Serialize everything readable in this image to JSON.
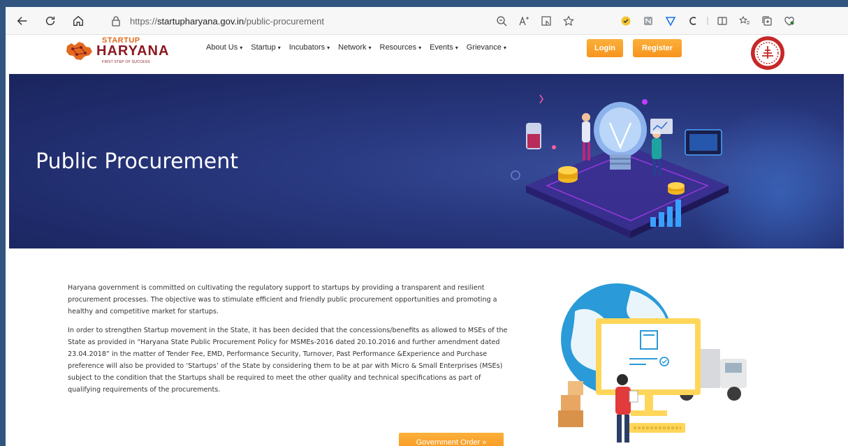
{
  "browser": {
    "url_prefix": "https://",
    "url_host": "startupharyana.gov.in",
    "url_path": "/public-procurement",
    "back_icon": "back-arrow-icon",
    "refresh_icon": "refresh-icon",
    "home_icon": "home-icon"
  },
  "site": {
    "logo_top": "STARTUP",
    "logo_main": "HARYANA",
    "logo_tagline": "FIRST STEP OF SUCCESS",
    "nav": [
      {
        "label": "About Us"
      },
      {
        "label": "Startup"
      },
      {
        "label": "Incubators"
      },
      {
        "label": "Network"
      },
      {
        "label": "Resources"
      },
      {
        "label": "Events"
      },
      {
        "label": "Grievance"
      }
    ],
    "login_label": "Login",
    "register_label": "Register",
    "accent_color": "#f7941d",
    "brand_color": "#8a1a23"
  },
  "hero": {
    "title": "Public Procurement",
    "background_color": "#1f2b6a"
  },
  "content": {
    "paragraph_1": "Haryana government is committed on cultivating the regulatory support to startups by providing a transparent and resilient procurement processes. The objective was to stimulate efficient and friendly public procurement opportunities and promoting a healthy and competitive market for startups.",
    "paragraph_2": "In order to strengthen Startup movement in the State, it has been decided that the concessions/benefits as allowed to MSEs of the State as provided in “Haryana State Public Procurement Policy for MSMEs-2016 dated 20.10.2016 and further amendment dated 23.04.2018” in the matter of Tender Fee, EMD, Performance Security, Turnover, Past Performance &Experience and Purchase preference will also be provided to ‘Startups’ of the State by considering them to be at par with Micro & Small Enterprises (MSEs) subject to the condition that the Startups shall be required to meet the other quality and technical specifications as part of qualifying requirements of the procurements.",
    "button_label": "Government Order »"
  }
}
